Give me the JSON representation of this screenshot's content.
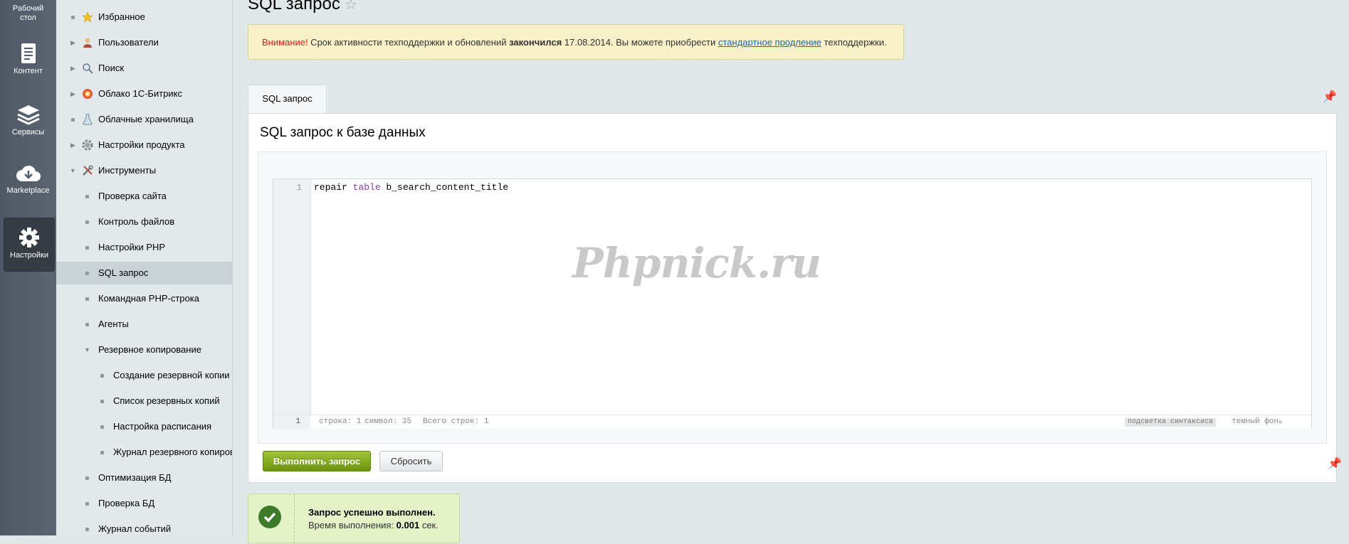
{
  "rail": {
    "desktop": "Рабочий стол",
    "content": "Контент",
    "services": "Сервисы",
    "marketplace": "Marketplace",
    "settings": "Настройки"
  },
  "menu": {
    "favorites": "Избранное",
    "users": "Пользователи",
    "search": "Поиск",
    "cloud": "Облако 1С-Битрикс",
    "cloud_storage": "Облачные хранилища",
    "product_settings": "Настройки продукта",
    "tools": "Инструменты",
    "site_check": "Проверка сайта",
    "file_control": "Контроль файлов",
    "php_settings": "Настройки PHP",
    "sql_query": "SQL запрос",
    "php_cmd": "Командная PHP-строка",
    "agents": "Агенты",
    "backup": "Резервное копирование",
    "backup_create": "Создание резервной копии",
    "backup_list": "Список резервных копий",
    "backup_schedule": "Настройка расписания",
    "backup_log": "Журнал резервного копирования",
    "db_optimize": "Оптимизация БД",
    "db_check": "Проверка БД",
    "event_log": "Журнал событий"
  },
  "page": {
    "title": "SQL запрос",
    "star": "☆"
  },
  "warning": {
    "attention": "Внимание!",
    "text1": " Срок активности техподдержки и обновлений ",
    "ended": "закончился",
    "text2": " 17.08.2014. Вы можете приобрести ",
    "link": "стандартное продление",
    "text3": " техподдержки."
  },
  "tab": {
    "label": "SQL запрос"
  },
  "panel": {
    "heading": "SQL запрос к базе данных"
  },
  "editor": {
    "line_number": "1",
    "code_part1": "repair ",
    "code_keyword": "table",
    "code_part2": " b_search_content_title",
    "watermark": "Phpnick.ru",
    "cursor_line": "1",
    "status_row": "строка: 1",
    "status_symbol": "символ: 35",
    "status_total": "Всего строк: 1",
    "syntax_highlight": "подсветка синтаксиса",
    "dark_bg": "темный фон"
  },
  "buttons": {
    "run": "Выполнить запрос",
    "reset": "Сбросить"
  },
  "result": {
    "title": "Запрос успешно выполнен.",
    "time_label": "Время выполнения: ",
    "time_value": "0.001",
    "time_unit": " сек."
  },
  "colors": {
    "run_button": "#7fa61d",
    "warning_bg": "#f8f0c9",
    "success_bg": "#e5f1c6",
    "sidebar_bg": "#535c69"
  }
}
